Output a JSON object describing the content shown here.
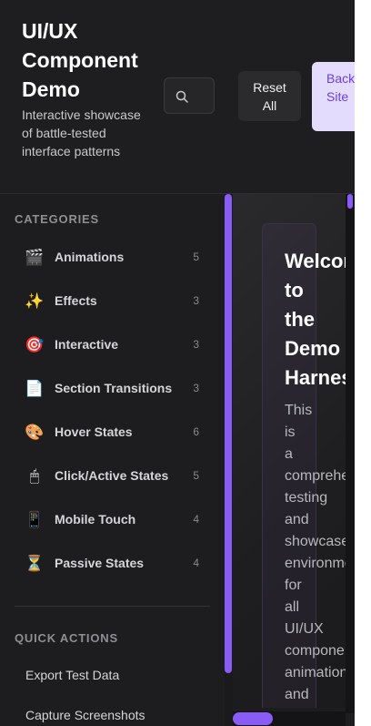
{
  "header": {
    "title": "UI/UX Component Demo",
    "subtitle": "Interactive showcase of battle-tested interface patterns",
    "search_icon": "search-icon",
    "reset_label": "Reset All",
    "back_label": "Back to Site"
  },
  "sidebar": {
    "categories_label": "CATEGORIES",
    "categories": [
      {
        "icon": "🎬",
        "icon_name": "clapper-icon",
        "label": "Animations",
        "count": "5"
      },
      {
        "icon": "✨",
        "icon_name": "sparkles-icon",
        "label": "Effects",
        "count": "3"
      },
      {
        "icon": "🎯",
        "icon_name": "target-icon",
        "label": "Interactive",
        "count": "3"
      },
      {
        "icon": "📄",
        "icon_name": "page-icon",
        "label": "Section Transitions",
        "count": "3"
      },
      {
        "icon": "🎨",
        "icon_name": "palette-icon",
        "label": "Hover States",
        "count": "6"
      },
      {
        "icon": "🖱",
        "icon_name": "mouse-icon",
        "label": "Click/Active States",
        "count": "5"
      },
      {
        "icon": "📱",
        "icon_name": "mobile-icon",
        "label": "Mobile Touch",
        "count": "4"
      },
      {
        "icon": "⏳",
        "icon_name": "hourglass-icon",
        "label": "Passive States",
        "count": "4"
      }
    ],
    "quick_actions_label": "QUICK ACTIONS",
    "quick_actions": [
      {
        "label": "Export Test Data"
      },
      {
        "label": "Capture Screenshots"
      }
    ]
  },
  "main": {
    "welcome_title": "Welcome\nto\nthe\nDemo\nHarness",
    "welcome_body": "This\nis\na\ncomprehensive\ntesting\nand\nshowcase\nenvironment\nfor\nall\nUI/UX\ncomponents,\nanimations\nand\neffects"
  },
  "colors": {
    "accent": "#8a5cf6",
    "back_button_bg": "#e4dcfd",
    "back_button_text": "#6b3fe0",
    "background": "#1c1c1e"
  }
}
